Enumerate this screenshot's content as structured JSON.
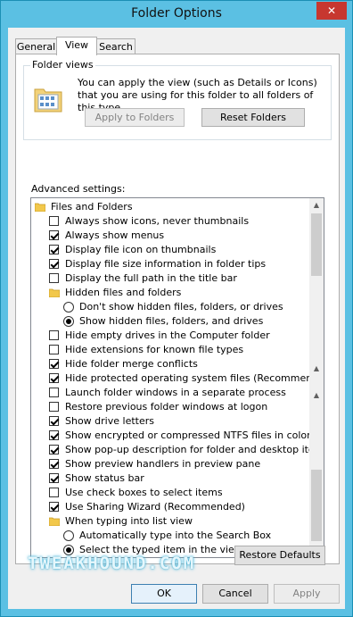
{
  "window": {
    "title": "Folder Options",
    "close_glyph": "✕"
  },
  "tabs": [
    {
      "label": "General",
      "active": false
    },
    {
      "label": "View",
      "active": true
    },
    {
      "label": "Search",
      "active": false
    }
  ],
  "folder_views": {
    "label": "Folder views",
    "description": "You can apply the view (such as Details or Icons) that you are using for this folder to all folders of this type.",
    "apply_label": "Apply to Folders",
    "reset_label": "Reset Folders"
  },
  "advanced": {
    "label": "Advanced settings:",
    "items": [
      {
        "type": "folder",
        "label": "Files and Folders",
        "level": 0
      },
      {
        "type": "check",
        "checked": false,
        "label": "Always show icons, never thumbnails",
        "level": 1
      },
      {
        "type": "check",
        "checked": true,
        "label": "Always show menus",
        "level": 1
      },
      {
        "type": "check",
        "checked": true,
        "label": "Display file icon on thumbnails",
        "level": 1
      },
      {
        "type": "check",
        "checked": true,
        "label": "Display file size information in folder tips",
        "level": 1
      },
      {
        "type": "check",
        "checked": false,
        "label": "Display the full path in the title bar",
        "level": 1
      },
      {
        "type": "folder",
        "label": "Hidden files and folders",
        "level": 1
      },
      {
        "type": "radio",
        "checked": false,
        "label": "Don't show hidden files, folders, or drives",
        "level": 2
      },
      {
        "type": "radio",
        "checked": true,
        "label": "Show hidden files, folders, and drives",
        "level": 2
      },
      {
        "type": "check",
        "checked": false,
        "label": "Hide empty drives in the Computer folder",
        "level": 1
      },
      {
        "type": "check",
        "checked": false,
        "label": "Hide extensions for known file types",
        "level": 1
      },
      {
        "type": "check",
        "checked": true,
        "label": "Hide folder merge conflicts",
        "level": 1
      },
      {
        "type": "check",
        "checked": true,
        "label": "Hide protected operating system files (Recommended)",
        "level": 1
      },
      {
        "type": "check",
        "checked": false,
        "label": "Launch folder windows in a separate process",
        "level": 1
      },
      {
        "type": "check",
        "checked": false,
        "label": "Restore previous folder windows at logon",
        "level": 1
      },
      {
        "type": "check",
        "checked": true,
        "label": "Show drive letters",
        "level": 1
      },
      {
        "type": "check",
        "checked": true,
        "label": "Show encrypted or compressed NTFS files in color",
        "level": 1
      },
      {
        "type": "check",
        "checked": true,
        "label": "Show pop-up description for folder and desktop items",
        "level": 1
      },
      {
        "type": "check",
        "checked": true,
        "label": "Show preview handlers in preview pane",
        "level": 1
      },
      {
        "type": "check",
        "checked": true,
        "label": "Show status bar",
        "level": 1
      },
      {
        "type": "check",
        "checked": false,
        "label": "Use check boxes to select items",
        "level": 1
      },
      {
        "type": "check",
        "checked": true,
        "label": "Use Sharing Wizard (Recommended)",
        "level": 1
      },
      {
        "type": "folder",
        "label": "When typing into list view",
        "level": 1
      },
      {
        "type": "radio",
        "checked": false,
        "label": "Automatically type into the Search Box",
        "level": 2
      },
      {
        "type": "radio",
        "checked": true,
        "label": "Select the typed item in the view",
        "level": 2
      }
    ]
  },
  "restore_defaults_label": "Restore Defaults",
  "watermark": "TWEAKHOUND.COM",
  "footer": {
    "ok_label": "OK",
    "cancel_label": "Cancel",
    "apply_label": "Apply"
  },
  "colors": {
    "titlebar": "#5bc0e3",
    "close": "#c7372f"
  },
  "icons": {
    "folder": "folder-icon",
    "close": "close-icon",
    "scroll_up": "chevron-up-icon",
    "scroll_down": "chevron-down-icon"
  }
}
